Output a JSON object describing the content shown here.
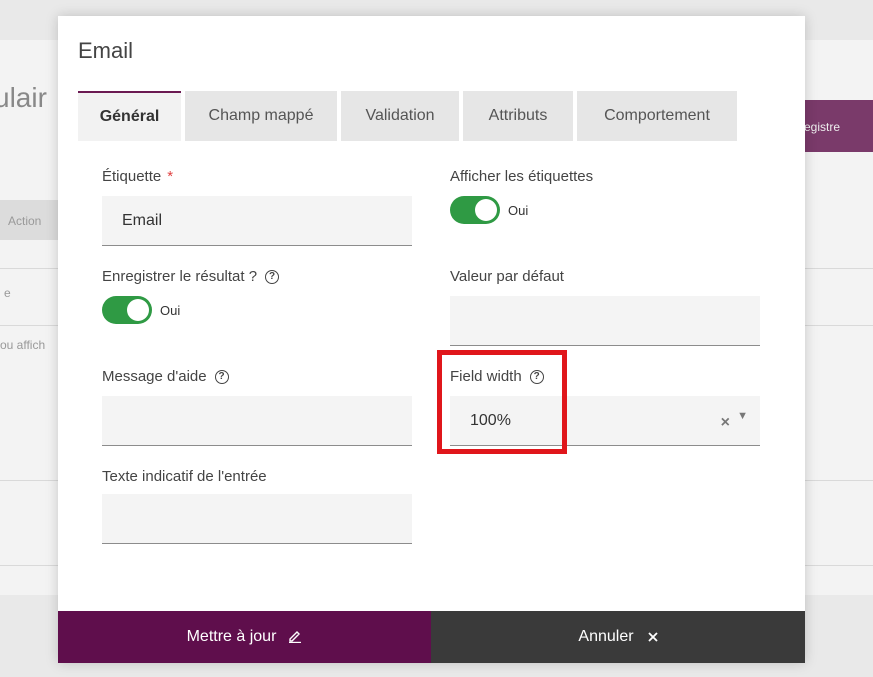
{
  "background": {
    "title_fragment": "ulair",
    "button_fragment": "egistre",
    "chip_fragment": "Action",
    "text_fragment_1": "e",
    "text_fragment_2": "ou affich"
  },
  "modal": {
    "title": "Email",
    "tabs": [
      {
        "label": "Général",
        "active": true
      },
      {
        "label": "Champ mappé",
        "active": false
      },
      {
        "label": "Validation",
        "active": false
      },
      {
        "label": "Attributs",
        "active": false
      },
      {
        "label": "Comportement",
        "active": false
      }
    ],
    "fields": {
      "etiquette": {
        "label": "Étiquette",
        "required_marker": "*",
        "value": "Email"
      },
      "afficher_etiquettes": {
        "label": "Afficher les étiquettes",
        "toggle_label": "Oui",
        "on": true
      },
      "enregistrer_resultat": {
        "label": "Enregistrer le résultat ?",
        "toggle_label": "Oui",
        "on": true
      },
      "valeur_defaut": {
        "label": "Valeur par défaut",
        "value": ""
      },
      "message_aide": {
        "label": "Message d'aide",
        "value": ""
      },
      "field_width": {
        "label": "Field width",
        "value": "100%",
        "clear_icon": "×",
        "dropdown_icon": "▼"
      },
      "texte_indicatif": {
        "label": "Texte indicatif de l'entrée",
        "value": ""
      }
    },
    "help_icon_glyph": "?",
    "footer": {
      "update_label": "Mettre à jour",
      "update_icon": "pencil-icon",
      "cancel_label": "Annuler",
      "cancel_icon": "close-icon"
    }
  },
  "colors": {
    "accent": "#5f0e4c",
    "toggle_on": "#2f9a44",
    "highlight": "#e0161b",
    "cancel_bg": "#3a3a3a"
  }
}
